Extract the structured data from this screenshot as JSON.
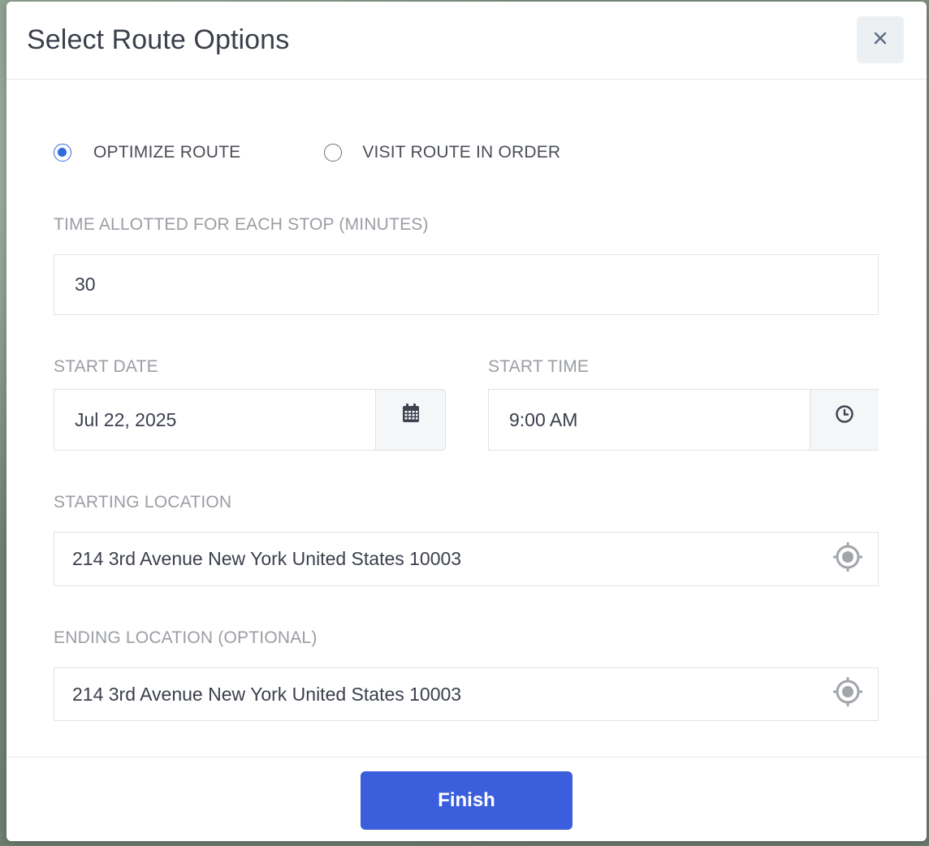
{
  "modal": {
    "title": "Select Route Options",
    "close_icon": "close-icon"
  },
  "route_mode": {
    "options": [
      {
        "label": "OPTIMIZE ROUTE",
        "selected": true
      },
      {
        "label": "VISIT ROUTE IN ORDER",
        "selected": false
      }
    ]
  },
  "time_per_stop": {
    "label": "TIME ALLOTTED FOR EACH STOP (MINUTES)",
    "value": "30"
  },
  "start_date": {
    "label": "START DATE",
    "value": "Jul 22, 2025",
    "icon": "calendar-icon"
  },
  "start_time": {
    "label": "START TIME",
    "value": "9:00 AM",
    "icon": "clock-icon"
  },
  "starting_location": {
    "label": "STARTING LOCATION",
    "value": "214 3rd Avenue New York United States 10003",
    "icon": "crosshair-icon"
  },
  "ending_location": {
    "label": "ENDING LOCATION (OPTIONAL)",
    "value": "214 3rd Avenue New York United States 10003",
    "icon": "crosshair-icon"
  },
  "footer": {
    "finish_label": "Finish"
  },
  "colors": {
    "accent": "#2f6bdc",
    "button": "#3b5fdc",
    "label": "#9a9da3",
    "text": "#3a3f4b"
  }
}
